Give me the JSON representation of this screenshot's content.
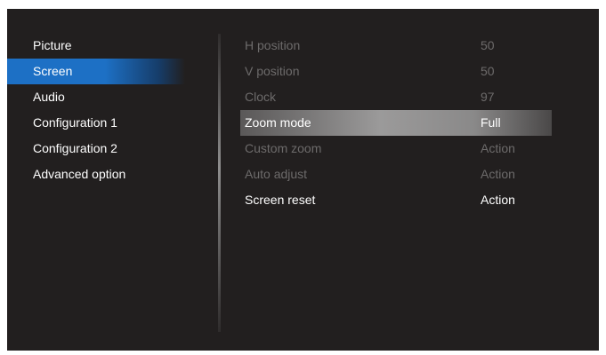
{
  "left_menu": {
    "items": [
      {
        "label": "Picture"
      },
      {
        "label": "Screen"
      },
      {
        "label": "Audio"
      },
      {
        "label": "Configuration 1"
      },
      {
        "label": "Configuration 2"
      },
      {
        "label": "Advanced option"
      }
    ],
    "selected_index": 1
  },
  "screen_settings": {
    "rows": [
      {
        "label": "H position",
        "value": "50",
        "state": "disabled"
      },
      {
        "label": "V position",
        "value": "50",
        "state": "disabled"
      },
      {
        "label": "Clock",
        "value": "97",
        "state": "disabled"
      },
      {
        "label": "Zoom mode",
        "value": "Full",
        "state": "highlighted"
      },
      {
        "label": "Custom zoom",
        "value": "Action",
        "state": "disabled"
      },
      {
        "label": "Auto adjust",
        "value": "Action",
        "state": "disabled"
      },
      {
        "label": "Screen reset",
        "value": "Action",
        "state": "enabled"
      }
    ]
  },
  "colors": {
    "background": "#221f1f",
    "selection_blue": "#1d70c5",
    "disabled_text": "#6d6b6b",
    "highlight_gray": "#9b9a9a"
  }
}
